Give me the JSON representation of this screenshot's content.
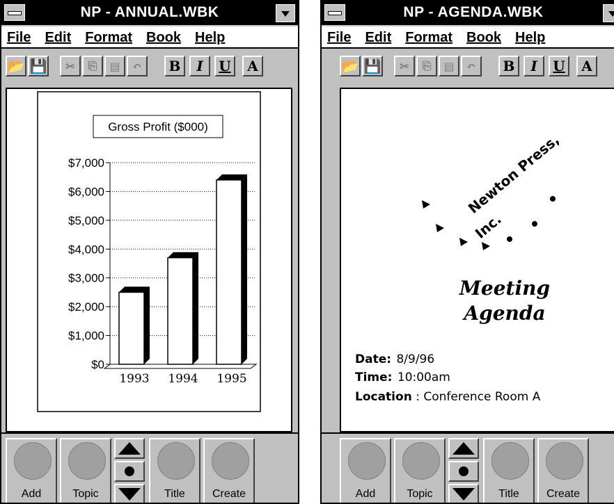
{
  "left_window": {
    "title": "NP - ANNUAL.WBK",
    "menu": [
      "File",
      "Edit",
      "Format",
      "Book",
      "Help"
    ],
    "bottom_buttons": [
      "Add",
      "Topic",
      "Title",
      "Create"
    ]
  },
  "right_window": {
    "title": "NP - AGENDA.WBK",
    "menu": [
      "File",
      "Edit",
      "Format",
      "Book",
      "Help"
    ],
    "logo_line1": "Newton Press,",
    "logo_line2": "Inc.",
    "heading_line1": "Meeting",
    "heading_line2": "Agenda",
    "date_label": "Date:",
    "date_value": "8/9/96",
    "time_label": "Time:",
    "time_value": "10:00am",
    "location_label": "Location",
    "location_value": ": Conference Room A",
    "bottom_buttons": [
      "Add",
      "Topic",
      "Title",
      "Create"
    ]
  },
  "toolbar_glyphs": {
    "bold": "B",
    "italic": "I",
    "underline": "U",
    "font": "A"
  },
  "chart_data": {
    "type": "bar",
    "title": "Gross Profit ($000)",
    "categories": [
      "1993",
      "1994",
      "1995"
    ],
    "values": [
      2500,
      3700,
      6400
    ],
    "ylim": [
      0,
      7000
    ],
    "yticks": [
      "$0",
      "$1,000",
      "$2,000",
      "$3,000",
      "$4,000",
      "$5,000",
      "$6,000",
      "$7,000"
    ],
    "grid": true,
    "xlabel": "",
    "ylabel": ""
  }
}
